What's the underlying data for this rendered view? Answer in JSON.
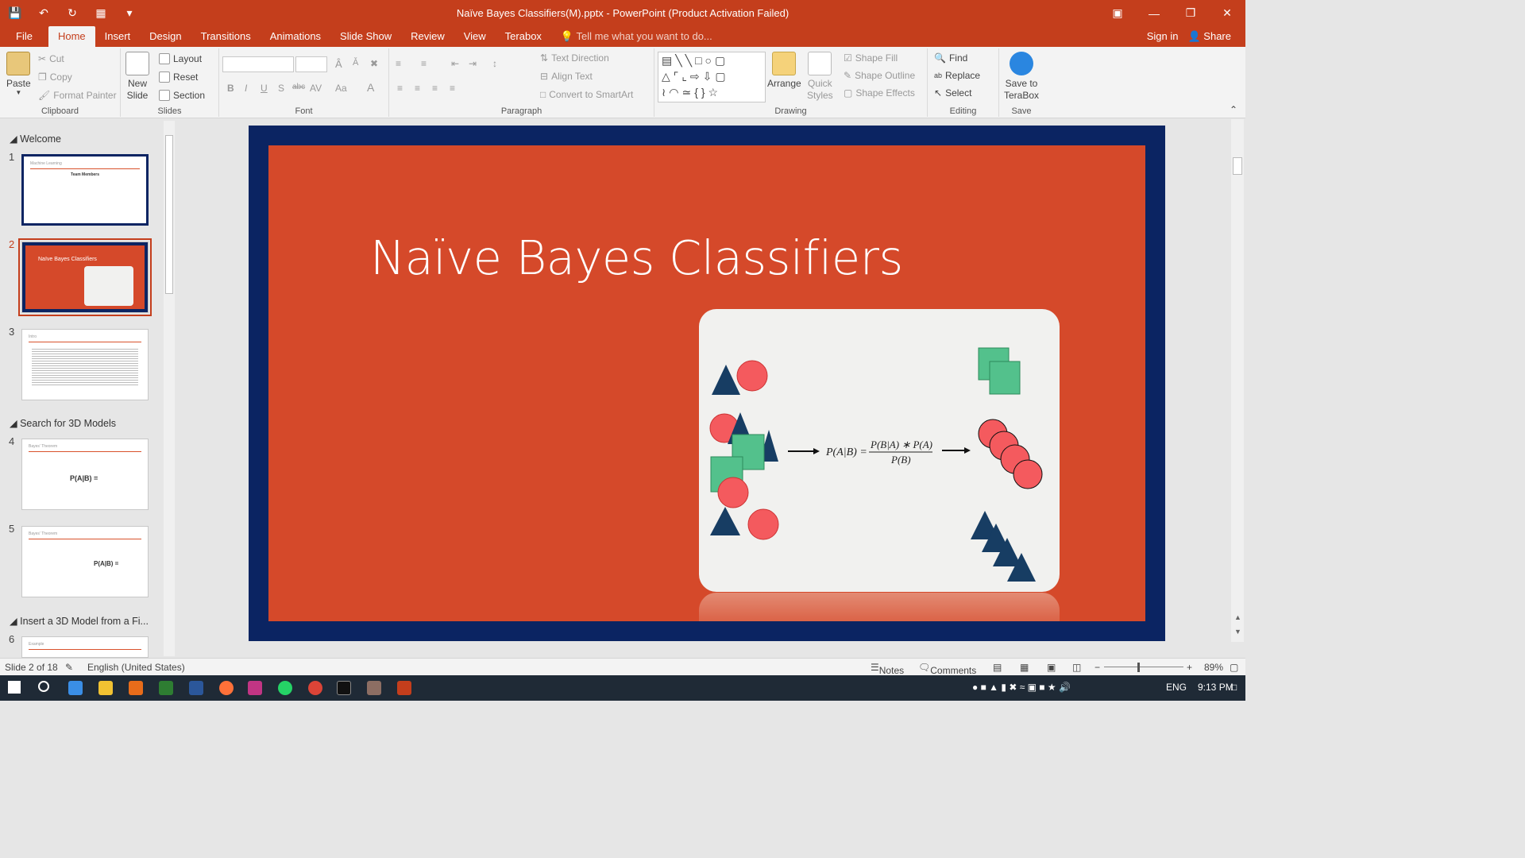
{
  "window": {
    "title": "Naïve Bayes Classifiers(M).pptx - PowerPoint (Product Activation Failed)"
  },
  "tabs": {
    "file": "File",
    "home": "Home",
    "insert": "Insert",
    "design": "Design",
    "transitions": "Transitions",
    "animations": "Animations",
    "slideshow": "Slide Show",
    "review": "Review",
    "view": "View",
    "terabox": "Terabox",
    "tell_me": "Tell me what you want to do...",
    "sign_in": "Sign in",
    "share": "Share"
  },
  "ribbon": {
    "clipboard": {
      "paste": "Paste",
      "cut": "Cut",
      "copy": "Copy",
      "format_painter": "Format Painter",
      "label": "Clipboard"
    },
    "slides": {
      "new_slide": "New",
      "new_slide2": "Slide",
      "layout": "Layout",
      "reset": "Reset",
      "section": "Section",
      "label": "Slides"
    },
    "font": {
      "label": "Font"
    },
    "paragraph": {
      "text_direction": "Text Direction",
      "align_text": "Align Text",
      "smartart": "Convert to SmartArt",
      "label": "Paragraph"
    },
    "drawing": {
      "arrange": "Arrange",
      "quick": "Quick",
      "styles": "Styles",
      "shape_fill": "Shape Fill",
      "shape_outline": "Shape Outline",
      "shape_effects": "Shape Effects",
      "label": "Drawing"
    },
    "editing": {
      "find": "Find",
      "replace": "Replace",
      "select": "Select",
      "label": "Editing"
    },
    "save": {
      "save_to": "Save to",
      "terabox": "TeraBox",
      "label": "Save"
    }
  },
  "slide_panel": {
    "sections": [
      "Welcome",
      "Search for 3D Models",
      "Insert a 3D Model from a Fi..."
    ],
    "slide_numbers": [
      "1",
      "2",
      "3",
      "4",
      "5",
      "6"
    ],
    "thumb1": {
      "title": "Machine Learning",
      "heading": "Team Members"
    },
    "thumb2": {
      "title": "Naïve Bayes Classifiers"
    },
    "thumb3": {
      "title": "Intro"
    },
    "thumb4": {
      "title": "Bayes' Theorem",
      "formula": "P(A|B) ="
    },
    "thumb5": {
      "title": "Bayes' Theorem",
      "formula": "P(A|B) ="
    },
    "thumb6": {
      "title": "Example"
    }
  },
  "slide": {
    "title": "Naïve Bayes Classifiers",
    "formula_lhs": "P(A|B) =",
    "formula_num": "P(B|A) ∗ P(A)",
    "formula_den": "P(B)"
  },
  "status": {
    "slide_info": "Slide 2 of 18",
    "language": "English (United States)",
    "notes": "Notes",
    "comments": "Comments",
    "zoom": "89%"
  },
  "taskbar": {
    "lang": "ENG",
    "time": "9:13 PM"
  },
  "colors": {
    "accent": "#c43e1c",
    "slide_bg": "#d5492a",
    "slide_border": "#0b2462"
  }
}
